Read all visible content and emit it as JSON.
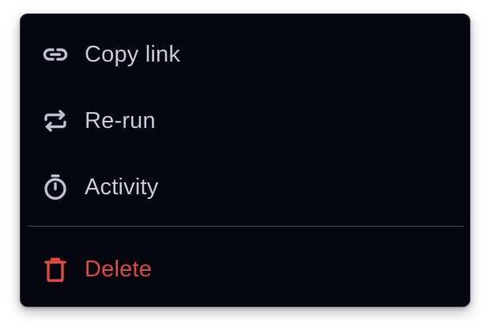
{
  "menu": {
    "items": [
      {
        "label": "Copy link",
        "icon": "link-icon"
      },
      {
        "label": "Re-run",
        "icon": "repeat-icon"
      },
      {
        "label": "Activity",
        "icon": "stopwatch-icon"
      }
    ],
    "danger_item": {
      "label": "Delete",
      "icon": "trash-icon"
    }
  },
  "colors": {
    "background": "#03060f",
    "border": "#3b4257",
    "text": "#c5cad6",
    "icon": "#b9bfcc",
    "danger": "#e0483e"
  }
}
